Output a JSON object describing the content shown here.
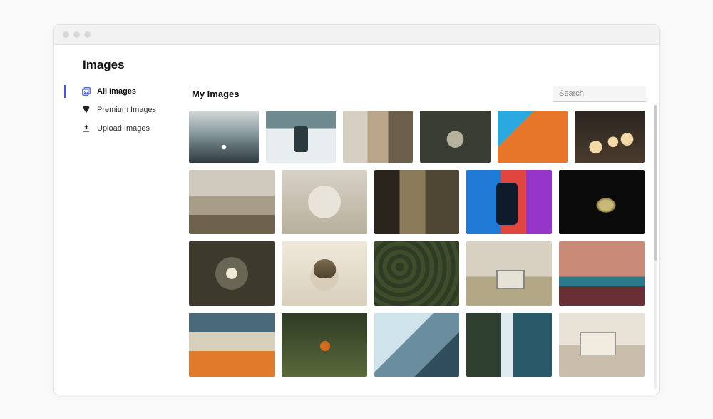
{
  "page": {
    "title": "Images"
  },
  "sidebar": {
    "items": [
      {
        "label": "All Images",
        "active": true
      },
      {
        "label": "Premium Images",
        "active": false
      },
      {
        "label": "Upload Images",
        "active": false
      }
    ]
  },
  "main": {
    "title": "My Images",
    "search": {
      "placeholder": "Search",
      "value": ""
    }
  },
  "gallery": {
    "rows": [
      [
        "lake-figure",
        "snow-carry",
        "interior-table",
        "dried-flowers",
        "orange-building",
        "pastry-piping"
      ],
      [
        "bedroom-couple",
        "mother-baby",
        "reading-chair",
        "neon-silhouette",
        "coin-stack"
      ],
      [
        "dandelion-macro",
        "cat-portrait",
        "dark-greens",
        "two-women-laptop",
        "canyon-waterfall"
      ],
      [
        "couple-selfie",
        "wheat-field",
        "ice-texture",
        "forest-waterfall",
        "desk-laptop"
      ]
    ]
  }
}
